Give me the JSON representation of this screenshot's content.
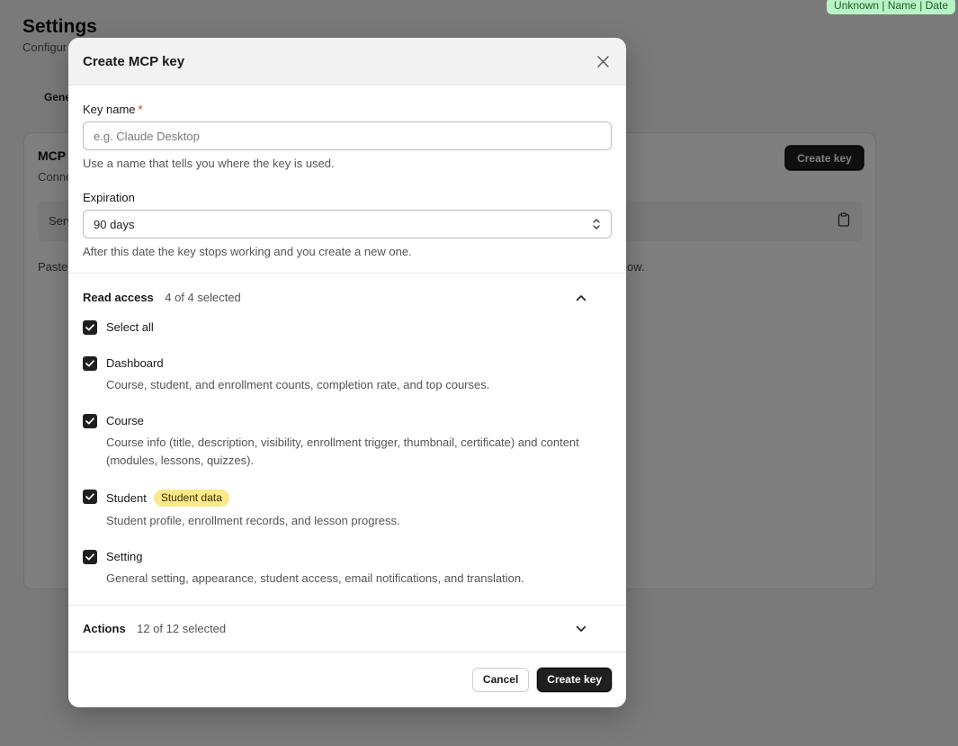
{
  "background": {
    "page_title": "Settings",
    "page_subtitle": "Configur",
    "tab_label": "Gene",
    "card_title": "MCP",
    "card_desc": "Conne",
    "create_key_label": "Create key",
    "server_label": "Serv",
    "paste_text": "Paste",
    "paste_tail": "ow."
  },
  "top_badge": "Unknown | Name | Date",
  "modal": {
    "title": "Create MCP key",
    "key_name": {
      "label": "Key name",
      "required_mark": "*",
      "placeholder": "e.g. Claude Desktop",
      "value": "",
      "help": "Use a name that tells you where the key is used."
    },
    "expiration": {
      "label": "Expiration",
      "value": "90 days",
      "help": "After this date the key stops working and you create a new one."
    },
    "read_access": {
      "title": "Read access",
      "count": "4 of 4 selected",
      "expanded": true,
      "select_all_label": "Select all",
      "items": [
        {
          "label": "Dashboard",
          "checked": true,
          "tag": "",
          "desc": "Course, student, and enrollment counts, completion rate, and top courses."
        },
        {
          "label": "Course",
          "checked": true,
          "tag": "",
          "desc": "Course info (title, description, visibility, enrollment trigger, thumbnail, certificate) and content (modules, lessons, quizzes)."
        },
        {
          "label": "Student",
          "checked": true,
          "tag": "Student data",
          "desc": "Student profile, enrollment records, and lesson progress."
        },
        {
          "label": "Setting",
          "checked": true,
          "tag": "",
          "desc": "General setting, appearance, student access, email notifications, and translation."
        }
      ]
    },
    "actions": {
      "title": "Actions",
      "count": "12 of 12 selected",
      "expanded": false
    },
    "footer": {
      "cancel_label": "Cancel",
      "create_label": "Create key"
    }
  },
  "colors": {
    "checkbox": "#1f1f1f",
    "tag_bg": "#fbe98a",
    "badge_bg": "#b7f5c4",
    "required": "#d0332b"
  }
}
